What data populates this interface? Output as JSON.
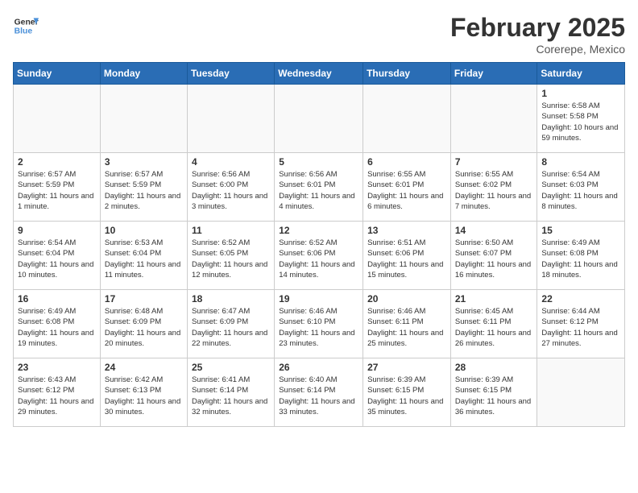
{
  "header": {
    "logo_line1": "General",
    "logo_line2": "Blue",
    "month": "February 2025",
    "location": "Corerepe, Mexico"
  },
  "weekdays": [
    "Sunday",
    "Monday",
    "Tuesday",
    "Wednesday",
    "Thursday",
    "Friday",
    "Saturday"
  ],
  "weeks": [
    [
      {
        "day": "",
        "info": ""
      },
      {
        "day": "",
        "info": ""
      },
      {
        "day": "",
        "info": ""
      },
      {
        "day": "",
        "info": ""
      },
      {
        "day": "",
        "info": ""
      },
      {
        "day": "",
        "info": ""
      },
      {
        "day": "1",
        "info": "Sunrise: 6:58 AM\nSunset: 5:58 PM\nDaylight: 10 hours and 59 minutes."
      }
    ],
    [
      {
        "day": "2",
        "info": "Sunrise: 6:57 AM\nSunset: 5:59 PM\nDaylight: 11 hours and 1 minute."
      },
      {
        "day": "3",
        "info": "Sunrise: 6:57 AM\nSunset: 5:59 PM\nDaylight: 11 hours and 2 minutes."
      },
      {
        "day": "4",
        "info": "Sunrise: 6:56 AM\nSunset: 6:00 PM\nDaylight: 11 hours and 3 minutes."
      },
      {
        "day": "5",
        "info": "Sunrise: 6:56 AM\nSunset: 6:01 PM\nDaylight: 11 hours and 4 minutes."
      },
      {
        "day": "6",
        "info": "Sunrise: 6:55 AM\nSunset: 6:01 PM\nDaylight: 11 hours and 6 minutes."
      },
      {
        "day": "7",
        "info": "Sunrise: 6:55 AM\nSunset: 6:02 PM\nDaylight: 11 hours and 7 minutes."
      },
      {
        "day": "8",
        "info": "Sunrise: 6:54 AM\nSunset: 6:03 PM\nDaylight: 11 hours and 8 minutes."
      }
    ],
    [
      {
        "day": "9",
        "info": "Sunrise: 6:54 AM\nSunset: 6:04 PM\nDaylight: 11 hours and 10 minutes."
      },
      {
        "day": "10",
        "info": "Sunrise: 6:53 AM\nSunset: 6:04 PM\nDaylight: 11 hours and 11 minutes."
      },
      {
        "day": "11",
        "info": "Sunrise: 6:52 AM\nSunset: 6:05 PM\nDaylight: 11 hours and 12 minutes."
      },
      {
        "day": "12",
        "info": "Sunrise: 6:52 AM\nSunset: 6:06 PM\nDaylight: 11 hours and 14 minutes."
      },
      {
        "day": "13",
        "info": "Sunrise: 6:51 AM\nSunset: 6:06 PM\nDaylight: 11 hours and 15 minutes."
      },
      {
        "day": "14",
        "info": "Sunrise: 6:50 AM\nSunset: 6:07 PM\nDaylight: 11 hours and 16 minutes."
      },
      {
        "day": "15",
        "info": "Sunrise: 6:49 AM\nSunset: 6:08 PM\nDaylight: 11 hours and 18 minutes."
      }
    ],
    [
      {
        "day": "16",
        "info": "Sunrise: 6:49 AM\nSunset: 6:08 PM\nDaylight: 11 hours and 19 minutes."
      },
      {
        "day": "17",
        "info": "Sunrise: 6:48 AM\nSunset: 6:09 PM\nDaylight: 11 hours and 20 minutes."
      },
      {
        "day": "18",
        "info": "Sunrise: 6:47 AM\nSunset: 6:09 PM\nDaylight: 11 hours and 22 minutes."
      },
      {
        "day": "19",
        "info": "Sunrise: 6:46 AM\nSunset: 6:10 PM\nDaylight: 11 hours and 23 minutes."
      },
      {
        "day": "20",
        "info": "Sunrise: 6:46 AM\nSunset: 6:11 PM\nDaylight: 11 hours and 25 minutes."
      },
      {
        "day": "21",
        "info": "Sunrise: 6:45 AM\nSunset: 6:11 PM\nDaylight: 11 hours and 26 minutes."
      },
      {
        "day": "22",
        "info": "Sunrise: 6:44 AM\nSunset: 6:12 PM\nDaylight: 11 hours and 27 minutes."
      }
    ],
    [
      {
        "day": "23",
        "info": "Sunrise: 6:43 AM\nSunset: 6:12 PM\nDaylight: 11 hours and 29 minutes."
      },
      {
        "day": "24",
        "info": "Sunrise: 6:42 AM\nSunset: 6:13 PM\nDaylight: 11 hours and 30 minutes."
      },
      {
        "day": "25",
        "info": "Sunrise: 6:41 AM\nSunset: 6:14 PM\nDaylight: 11 hours and 32 minutes."
      },
      {
        "day": "26",
        "info": "Sunrise: 6:40 AM\nSunset: 6:14 PM\nDaylight: 11 hours and 33 minutes."
      },
      {
        "day": "27",
        "info": "Sunrise: 6:39 AM\nSunset: 6:15 PM\nDaylight: 11 hours and 35 minutes."
      },
      {
        "day": "28",
        "info": "Sunrise: 6:39 AM\nSunset: 6:15 PM\nDaylight: 11 hours and 36 minutes."
      },
      {
        "day": "",
        "info": ""
      }
    ]
  ]
}
